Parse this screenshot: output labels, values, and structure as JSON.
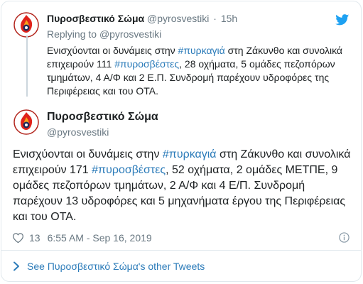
{
  "parent_tweet": {
    "name": "Πυροσβεστικό Σώμα",
    "handle": "@pyrosvestiki",
    "separator": "·",
    "time": "15h",
    "reply_prefix": "Replying to",
    "reply_handle": "@pyrosvestiki",
    "text_1": "Ενισχύονται οι δυνάμεις στην ",
    "hashtag_1": "#πυρκαγιά",
    "text_2": " στη Ζάκυνθο και συνολικά επιχειρούν 111 ",
    "hashtag_2": "#πυροσβέστες",
    "text_3": ", 28 οχήματα, 5 ομάδες πεζοπόρων τμημάτων, 4 Α/Φ και 2 Ε.Π. Συνδρομή παρέχουν υδροφόρες της Περιφέρειας και του ΟΤΑ."
  },
  "main_tweet": {
    "name": "Πυροσβεστικό Σώμα",
    "handle": "@pyrosvestiki",
    "text_1": "Ενισχύονται οι δυνάμεις στην ",
    "hashtag_1": "#πυρκαγιά",
    "text_2": " στη Ζάκυνθο και συνολικά επιχειρούν 171 ",
    "hashtag_2": "#πυροσβέστες",
    "text_3": ", 52 οχήματα, 2 ομάδες ΜΕΤΠΕ, 9 ομάδες πεζοπόρων τμημάτων, 2 Α/Φ και 4 Ε/Π. Συνδρομή παρέχουν 13 υδροφόρες και 5 μηχανήματα έργου της Περιφέρειας και του ΟΤΑ.",
    "likes": "13",
    "timestamp": "6:55 AM - Sep 16, 2019"
  },
  "footer": {
    "link_text": "See Πυροσβεστικό Σώμα's other Tweets"
  },
  "icons": {
    "brand_color": "#1da1f2",
    "avatar_flame_color": "#e0221b",
    "avatar_ring_color": "#b3261e",
    "link_color": "#2b7bb9",
    "muted_color": "#697882"
  }
}
